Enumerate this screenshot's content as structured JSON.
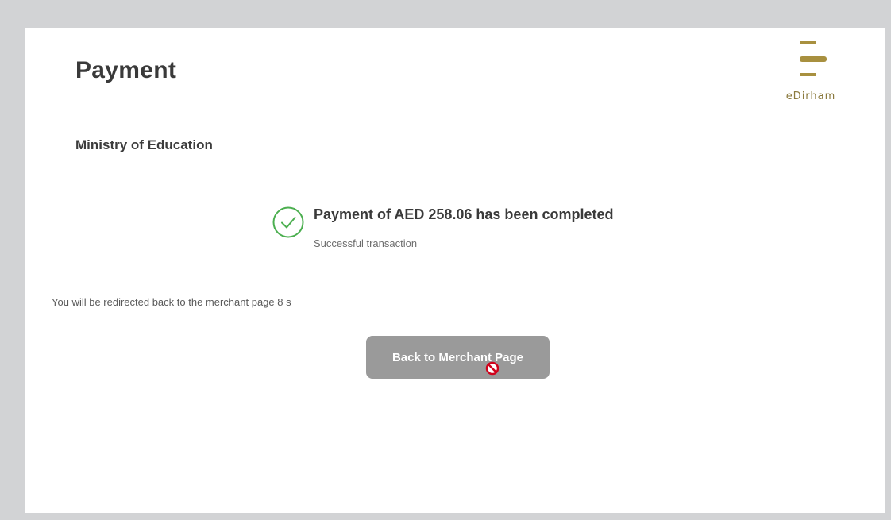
{
  "header": {
    "title": "Payment",
    "logo_text": "eDirham"
  },
  "merchant": {
    "name": "Ministry of Education"
  },
  "status": {
    "title": "Payment of AED 258.06 has been completed",
    "subtitle": "Successful transaction",
    "icon": "check-circle-icon"
  },
  "redirect": {
    "message": "You will be redirected back to the merchant page 8 s"
  },
  "actions": {
    "back_label": "Back to Merchant Page",
    "cursor": "not-allowed-cursor-icon"
  },
  "colors": {
    "background": "#d2d3d5",
    "card": "#ffffff",
    "success_green": "#4caf50",
    "brand_gold": "#a8903f",
    "button_gray": "#9a9a9a",
    "cursor_red": "#d0021b"
  }
}
